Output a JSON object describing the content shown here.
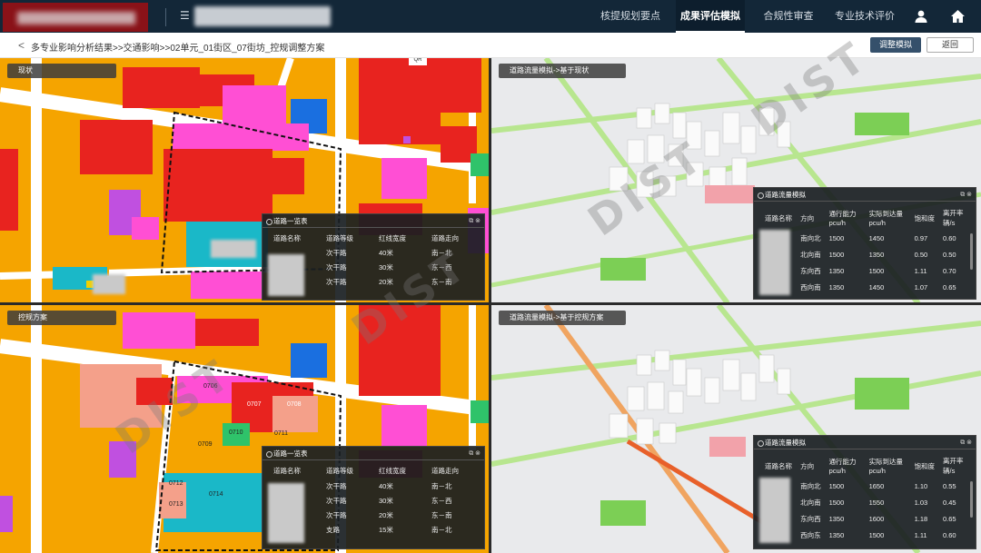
{
  "header": {
    "nav": [
      {
        "label": "核提规划要点",
        "active": false
      },
      {
        "label": "成果评估模拟",
        "active": true
      },
      {
        "label": "合规性审查",
        "active": false
      },
      {
        "label": "专业技术评价",
        "active": false
      }
    ],
    "icons": [
      "menu-icon",
      "user-icon",
      "home-icon"
    ],
    "bg_color": "#132738"
  },
  "breadcrumb": {
    "text": "多专业影响分析结果>>交通影响>>02单元_01街区_07街坊_控规调整方案",
    "adjust_button": "调整模拟",
    "back_button": "返回"
  },
  "panels": {
    "status_map": {
      "label": "现状"
    },
    "plan_map": {
      "label": "控规方案"
    },
    "flow_status": {
      "label": "道路流量模拟->基于现状"
    },
    "flow_plan": {
      "label": "道路流量模拟->基于控规方案"
    }
  },
  "road_table_status": {
    "title": "道路一览表",
    "headers": [
      "道路名称",
      "道路等级",
      "红线宽度",
      "道路走向"
    ],
    "rows": [
      [
        "次干路",
        "40米",
        "南－北"
      ],
      [
        "次干路",
        "30米",
        "东－西"
      ],
      [
        "次干路",
        "20米",
        "东－南"
      ]
    ]
  },
  "road_table_plan": {
    "title": "道路一览表",
    "headers": [
      "道路名称",
      "道路等级",
      "红线宽度",
      "道路走向"
    ],
    "rows": [
      [
        "次干路",
        "40米",
        "南－北"
      ],
      [
        "次干路",
        "30米",
        "东－西"
      ],
      [
        "次干路",
        "20米",
        "东－南"
      ],
      [
        "支路",
        "15米",
        "南－北"
      ]
    ]
  },
  "flow_table_status": {
    "title": "道路流量模拟",
    "headers": [
      "道路名称",
      "方向",
      "通行能力pcu/h",
      "实际到达量pcu/h",
      "饱和度",
      "离开率辆/s"
    ],
    "rows": [
      [
        "南向北",
        "1500",
        "1450",
        "0.97",
        "0.60"
      ],
      [
        "北向南",
        "1500",
        "1350",
        "0.50",
        "0.50"
      ],
      [
        "东向西",
        "1350",
        "1500",
        "1.11",
        "0.70"
      ],
      [
        "西向南",
        "1350",
        "1450",
        "1.07",
        "0.65"
      ]
    ]
  },
  "flow_table_plan": {
    "title": "道路流量模拟",
    "headers": [
      "道路名称",
      "方向",
      "通行能力pcu/h",
      "实际到达量pcu/h",
      "饱和度",
      "离开率辆/s"
    ],
    "rows": [
      [
        "南向北",
        "1500",
        "1650",
        "1.10",
        "0.55"
      ],
      [
        "北向南",
        "1500",
        "1550",
        "1.03",
        "0.45"
      ],
      [
        "东向西",
        "1350",
        "1600",
        "1.18",
        "0.65"
      ],
      [
        "西向东",
        "1350",
        "1500",
        "1.11",
        "0.60"
      ]
    ]
  },
  "plot_labels": [
    "0706",
    "0707",
    "0708",
    "0709",
    "0710",
    "0711",
    "0712",
    "0713",
    "0714"
  ],
  "map_badge": "QR",
  "watermark": "DIST"
}
